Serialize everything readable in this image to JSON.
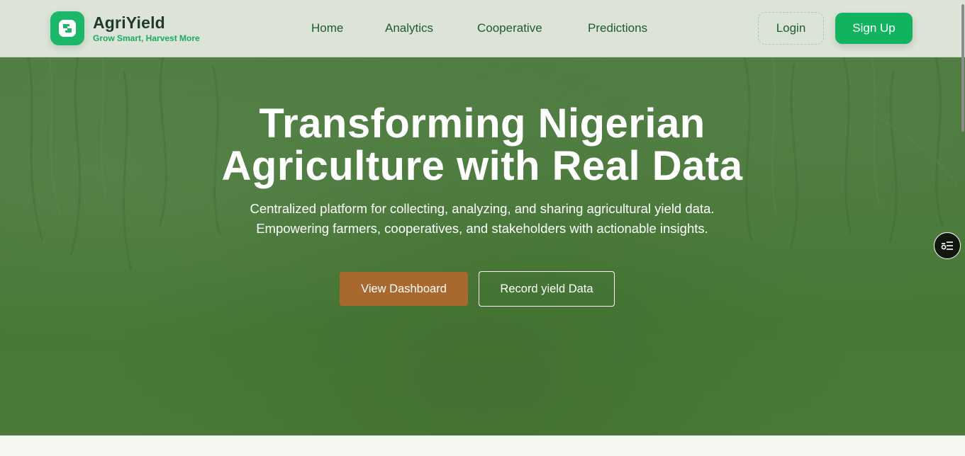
{
  "brand": {
    "name": "AgriYield",
    "tagline": "Grow Smart, Harvest More",
    "accent_color": "#12b35e",
    "logo_icon": "puzzle-icon"
  },
  "nav": {
    "items": [
      {
        "label": "Home"
      },
      {
        "label": "Analytics"
      },
      {
        "label": "Cooperative"
      },
      {
        "label": "Predictions"
      }
    ]
  },
  "auth": {
    "login_label": "Login",
    "signup_label": "Sign Up"
  },
  "hero": {
    "title_line1": "Transforming Nigerian",
    "title_line2": "Agriculture with Real Data",
    "subtitle_line1": "Centralized platform for collecting, analyzing, and sharing agricultural yield data.",
    "subtitle_line2": "Empowering farmers, cooperatives, and stakeholders with actionable insights.",
    "primary_cta": "View Dashboard",
    "secondary_cta": "Record yield Data",
    "primary_color": "#a9682e",
    "background_color": "#4a7a3b"
  },
  "widget": {
    "icon": "toggle-list-icon"
  }
}
